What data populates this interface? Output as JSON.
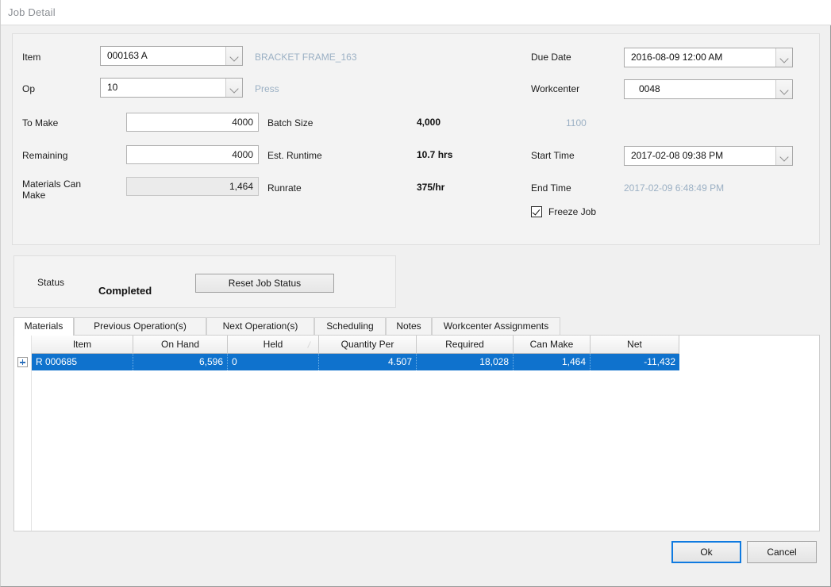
{
  "window": {
    "title": "Job Detail"
  },
  "detail": {
    "item": {
      "label": "Item",
      "value": "000163 A",
      "description": "BRACKET FRAME_163"
    },
    "op": {
      "label": "Op",
      "value": "10",
      "description": "Press"
    },
    "to_make": {
      "label": "To Make",
      "value": "4000"
    },
    "remaining": {
      "label": "Remaining",
      "value": "4000"
    },
    "materials_can_make": {
      "label_line1": "Materials Can",
      "label_line2": "Make",
      "value": "1,464"
    },
    "batch_size": {
      "label": "Batch Size",
      "value": "4,000"
    },
    "est_runtime": {
      "label": "Est. Runtime",
      "value": "10.7 hrs"
    },
    "runrate": {
      "label": "Runrate",
      "value": "375/hr"
    },
    "due_date": {
      "label": "Due Date",
      "value": "2016-08-09 12:00 AM"
    },
    "workcenter": {
      "label": "Workcenter",
      "value": "0048",
      "description": "1100"
    },
    "start_time": {
      "label": "Start Time",
      "value": "2017-02-08 09:38 PM"
    },
    "end_time": {
      "label": "End Time",
      "value": "2017-02-09 6:48:49 PM"
    },
    "freeze_job": {
      "label": "Freeze Job",
      "checked": true
    }
  },
  "status": {
    "label": "Status",
    "value": "Completed",
    "reset_button": "Reset Job Status"
  },
  "tabs": [
    {
      "label": "Materials",
      "active": true
    },
    {
      "label": "Previous Operation(s)",
      "active": false
    },
    {
      "label": "Next Operation(s)",
      "active": false
    },
    {
      "label": "Scheduling",
      "active": false
    },
    {
      "label": "Notes",
      "active": false
    },
    {
      "label": "Workcenter Assignments",
      "active": false
    }
  ],
  "grid": {
    "columns": [
      "Item",
      "On Hand",
      "Held",
      "Quantity Per",
      "Required",
      "Can Make",
      "Net"
    ],
    "sorted_column": "Held",
    "rows": [
      {
        "item": "R 000685",
        "on_hand": "6,596",
        "held": "0",
        "quantity_per": "4.507",
        "required": "18,028",
        "can_make": "1,464",
        "net": "-11,432",
        "selected": true,
        "expandable": true
      }
    ]
  },
  "footer": {
    "ok_label": "Ok",
    "cancel_label": "Cancel"
  },
  "colors": {
    "selection_blue": "#0f72cd",
    "focus_blue": "#0f7ae0",
    "muted_text": "#9bb0c4",
    "panel_bg": "#f3f3f3",
    "window_bg": "#f0f0f0"
  }
}
